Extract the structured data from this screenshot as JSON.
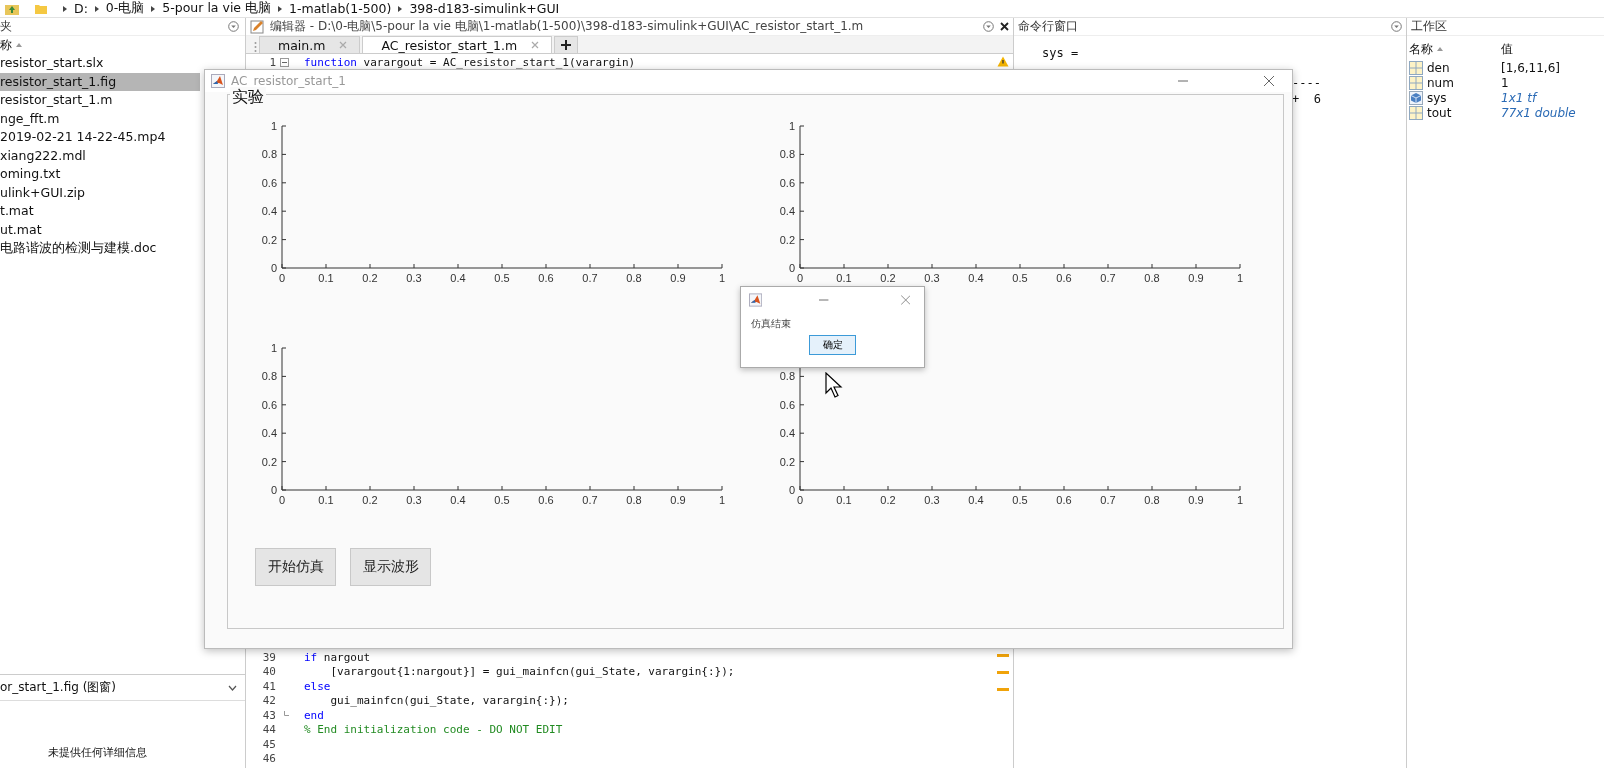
{
  "address_bar": {
    "crumbs": [
      "D:",
      "0-电脑",
      "5-pour la vie 电脑",
      "1-matlab(1-500)",
      "398-d183-simulink+GUI"
    ]
  },
  "file_browser": {
    "title": "夹",
    "column": "称",
    "files": [
      {
        "name": "resistor_start.slx",
        "selected": false
      },
      {
        "name": "resistor_start_1.fig",
        "selected": true
      },
      {
        "name": "resistor_start_1.m",
        "selected": false
      },
      {
        "name": "nge_fft.m",
        "selected": false
      },
      {
        "name": "2019-02-21 14-22-45.mp4",
        "selected": false
      },
      {
        "name": "xiang222.mdl",
        "selected": false
      },
      {
        "name": "oming.txt",
        "selected": false
      },
      {
        "name": "ulink+GUI.zip",
        "selected": false
      },
      {
        "name": "t.mat",
        "selected": false
      },
      {
        "name": "ut.mat",
        "selected": false
      },
      {
        "name": "电路谐波的检测与建模.doc",
        "selected": false
      }
    ],
    "details": {
      "file": "or_start_1.fig  (图窗)",
      "message": "未提供任何详细信息"
    }
  },
  "editor": {
    "title": "编辑器 - D:\\0-电脑\\5-pour la vie 电脑\\1-matlab(1-500)\\398-d183-simulink+GUI\\AC_resistor_start_1.m",
    "tabs": [
      {
        "label": "main.m",
        "selected": false
      },
      {
        "label": "AC_resistor_start_1.m",
        "selected": true
      }
    ],
    "lines": [
      {
        "number": "1",
        "fold_start": true,
        "fold_end": false,
        "tokens": [
          {
            "text": "function",
            "kind": "keyword"
          },
          {
            "text": " varargout = AC_resistor_start_1(varargin)",
            "kind": "plain"
          }
        ]
      },
      {
        "number": "39",
        "fold_start": false,
        "fold_end": false,
        "tokens": [
          {
            "text": "if",
            "kind": "keyword"
          },
          {
            "text": " nargout",
            "kind": "plain"
          }
        ]
      },
      {
        "number": "40",
        "fold_start": false,
        "fold_end": false,
        "tokens": [
          {
            "text": "    [varargout{1:nargout}] = gui_mainfcn(gui_State, varargin{:});",
            "kind": "plain"
          }
        ]
      },
      {
        "number": "41",
        "fold_start": false,
        "fold_end": false,
        "tokens": [
          {
            "text": "else",
            "kind": "keyword"
          }
        ]
      },
      {
        "number": "42",
        "fold_start": false,
        "fold_end": false,
        "tokens": [
          {
            "text": "    gui_mainfcn(gui_State, varargin{:});",
            "kind": "plain"
          }
        ]
      },
      {
        "number": "43",
        "fold_start": false,
        "fold_end": true,
        "tokens": [
          {
            "text": "end",
            "kind": "keyword"
          }
        ]
      },
      {
        "number": "44",
        "fold_start": false,
        "fold_end": false,
        "tokens": [
          {
            "text": "% End initialization code - DO NOT EDIT",
            "kind": "comment"
          }
        ]
      },
      {
        "number": "45",
        "fold_start": false,
        "fold_end": false
      },
      {
        "number": "46",
        "fold_start": false,
        "fold_end": false
      }
    ]
  },
  "command_window": {
    "title": "命令行窗口",
    "lines": [
      {
        "text": "sys =",
        "kind": "output"
      },
      {
        "text": "----",
        "kind": "fragment"
      },
      {
        "text": "+  6",
        "kind": "fragment"
      }
    ]
  },
  "workspace": {
    "title": "工作区",
    "columns": [
      "名称",
      "值"
    ],
    "variables": [
      {
        "name": "den",
        "value": "[1,6,11,6]",
        "kind": "matrix"
      },
      {
        "name": "num",
        "value": "1",
        "kind": "matrix"
      },
      {
        "name": "sys",
        "value": "1x1 tf",
        "kind": "object"
      },
      {
        "name": "tout",
        "value": "77x1 double",
        "kind": "object_matrix"
      }
    ]
  },
  "figure_window": {
    "title": "AC_resistor_start_1",
    "panel_title": "实验",
    "axes": [
      {
        "chart_data": {
          "type": "line",
          "xlim": [
            0,
            1
          ],
          "ylim": [
            0,
            1
          ],
          "xticks": [
            0,
            0.1,
            0.2,
            0.3,
            0.4,
            0.5,
            0.6,
            0.7,
            0.8,
            0.9,
            1
          ],
          "yticks": [
            0,
            0.2,
            0.4,
            0.6,
            0.8,
            1
          ]
        }
      },
      {
        "chart_data": {
          "type": "line",
          "xlim": [
            0,
            1
          ],
          "ylim": [
            0,
            1
          ],
          "xticks": [
            0,
            0.1,
            0.2,
            0.3,
            0.4,
            0.5,
            0.6,
            0.7,
            0.8,
            0.9,
            1
          ],
          "yticks": [
            0,
            0.2,
            0.4,
            0.6,
            0.8,
            1
          ]
        }
      },
      {
        "chart_data": {
          "type": "line",
          "xlim": [
            0,
            1
          ],
          "ylim": [
            0,
            1
          ],
          "xticks": [
            0,
            0.1,
            0.2,
            0.3,
            0.4,
            0.5,
            0.6,
            0.7,
            0.8,
            0.9,
            1
          ],
          "yticks": [
            0,
            0.2,
            0.4,
            0.6,
            0.8,
            1
          ]
        }
      },
      {
        "chart_data": {
          "type": "line",
          "xlim": [
            0,
            1
          ],
          "ylim": [
            0,
            1
          ],
          "xticks": [
            0,
            0.1,
            0.2,
            0.3,
            0.4,
            0.5,
            0.6,
            0.7,
            0.8,
            0.9,
            1
          ],
          "yticks": [
            0,
            0.2,
            0.4,
            0.6,
            0.8
          ]
        }
      }
    ],
    "buttons": [
      "开始仿真",
      "显示波形"
    ]
  },
  "dialog": {
    "message": "仿真结束",
    "button": "确定"
  }
}
